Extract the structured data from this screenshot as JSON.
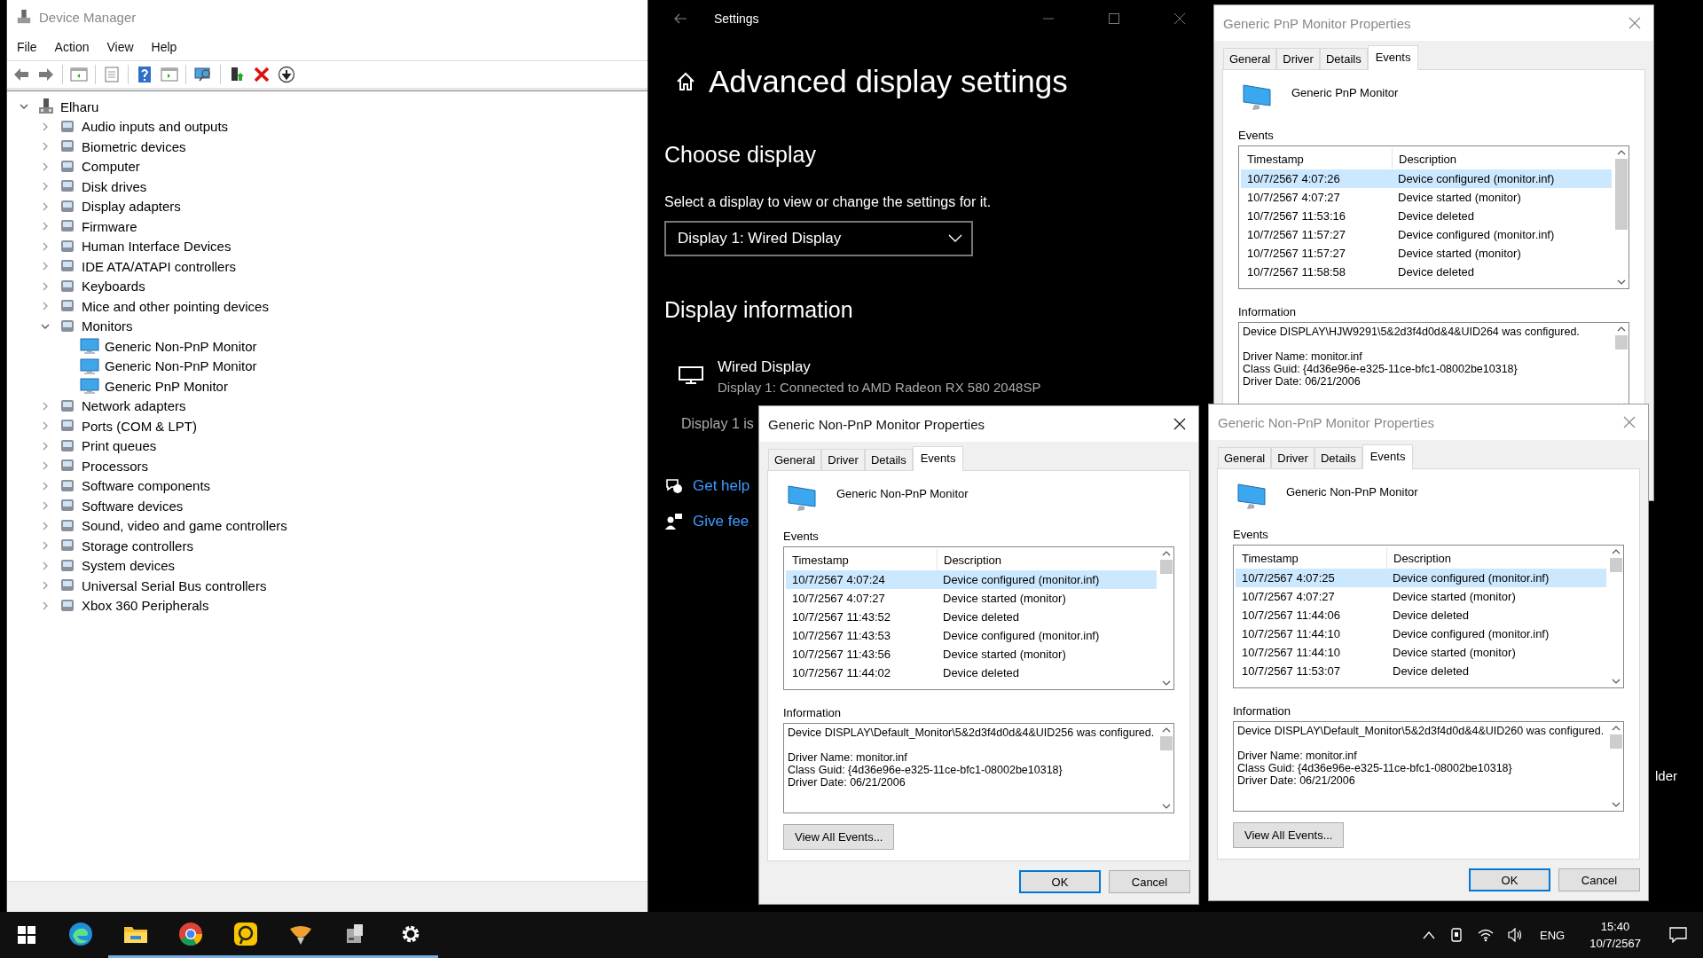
{
  "device_manager": {
    "title": "Device Manager",
    "menu": [
      "File",
      "Action",
      "View",
      "Help"
    ],
    "tree": {
      "label": "Elharu",
      "expanded": true,
      "children": [
        {
          "label": "Audio inputs and outputs",
          "expanded": false
        },
        {
          "label": "Biometric devices",
          "expanded": false
        },
        {
          "label": "Computer",
          "expanded": false
        },
        {
          "label": "Disk drives",
          "expanded": false
        },
        {
          "label": "Display adapters",
          "expanded": false
        },
        {
          "label": "Firmware",
          "expanded": false
        },
        {
          "label": "Human Interface Devices",
          "expanded": false
        },
        {
          "label": "IDE ATA/ATAPI controllers",
          "expanded": false
        },
        {
          "label": "Keyboards",
          "expanded": false
        },
        {
          "label": "Mice and other pointing devices",
          "expanded": false
        },
        {
          "label": "Monitors",
          "expanded": true,
          "children": [
            {
              "label": "Generic Non-PnP Monitor"
            },
            {
              "label": "Generic Non-PnP Monitor"
            },
            {
              "label": "Generic PnP Monitor"
            }
          ]
        },
        {
          "label": "Network adapters",
          "expanded": false
        },
        {
          "label": "Ports (COM & LPT)",
          "expanded": false
        },
        {
          "label": "Print queues",
          "expanded": false
        },
        {
          "label": "Processors",
          "expanded": false
        },
        {
          "label": "Software components",
          "expanded": false
        },
        {
          "label": "Software devices",
          "expanded": false
        },
        {
          "label": "Sound, video and game controllers",
          "expanded": false
        },
        {
          "label": "Storage controllers",
          "expanded": false
        },
        {
          "label": "System devices",
          "expanded": false
        },
        {
          "label": "Universal Serial Bus controllers",
          "expanded": false
        },
        {
          "label": "Xbox 360 Peripherals",
          "expanded": false
        }
      ]
    }
  },
  "settings": {
    "title": "Settings",
    "heading": "Advanced display settings",
    "choose_heading": "Choose display",
    "prompt": "Select a display to view or change the settings for it.",
    "display_select": "Display 1: Wired Display",
    "info_heading": "Display information",
    "display_name": "Wired Display",
    "display_detail": "Display 1: Connected to AMD Radeon RX 580 2048SP",
    "cut_text": "Display 1 is",
    "links": [
      "Get help",
      "Give fee"
    ]
  },
  "dialogs": [
    {
      "title": "Generic PnP Monitor Properties",
      "active": false,
      "tabs": [
        {
          "label": "General",
          "selected": false
        },
        {
          "label": "Driver",
          "selected": false
        },
        {
          "label": "Details",
          "selected": false
        },
        {
          "label": "Events",
          "selected": true
        }
      ],
      "device": "Generic PnP Monitor",
      "events_label": "Events",
      "columns": [
        "Timestamp",
        "Description"
      ],
      "rows": [
        {
          "timestamp": "10/7/2567 4:07:26",
          "description": "Device configured (monitor.inf)",
          "selected": true
        },
        {
          "timestamp": "10/7/2567 4:07:27",
          "description": "Device started (monitor)",
          "selected": false
        },
        {
          "timestamp": "10/7/2567 11:53:16",
          "description": "Device deleted",
          "selected": false
        },
        {
          "timestamp": "10/7/2567 11:57:27",
          "description": "Device configured (monitor.inf)",
          "selected": false
        },
        {
          "timestamp": "10/7/2567 11:57:27",
          "description": "Device started (monitor)",
          "selected": false
        },
        {
          "timestamp": "10/7/2567 11:58:58",
          "description": "Device deleted",
          "selected": false
        }
      ],
      "information_label": "Information",
      "information": [
        "Device DISPLAY\\HJW9291\\5&2d3f4d0d&4&UID264 was configured.",
        "Driver Name: monitor.inf",
        "Class Guid: {4d36e96e-e325-11ce-bfc1-08002be10318}",
        "Driver Date: 06/21/2006"
      ]
    },
    {
      "title": "Generic Non-PnP Monitor Properties",
      "active": true,
      "tabs": [
        {
          "label": "General",
          "selected": false
        },
        {
          "label": "Driver",
          "selected": false
        },
        {
          "label": "Details",
          "selected": false
        },
        {
          "label": "Events",
          "selected": true
        }
      ],
      "device": "Generic Non-PnP Monitor",
      "events_label": "Events",
      "columns": [
        "Timestamp",
        "Description"
      ],
      "rows": [
        {
          "timestamp": "10/7/2567 4:07:24",
          "description": "Device configured (monitor.inf)",
          "selected": true
        },
        {
          "timestamp": "10/7/2567 4:07:27",
          "description": "Device started (monitor)",
          "selected": false
        },
        {
          "timestamp": "10/7/2567 11:43:52",
          "description": "Device deleted",
          "selected": false
        },
        {
          "timestamp": "10/7/2567 11:43:53",
          "description": "Device configured (monitor.inf)",
          "selected": false
        },
        {
          "timestamp": "10/7/2567 11:43:56",
          "description": "Device started (monitor)",
          "selected": false
        },
        {
          "timestamp": "10/7/2567 11:44:02",
          "description": "Device deleted",
          "selected": false
        }
      ],
      "information_label": "Information",
      "information": [
        "Device DISPLAY\\Default_Monitor\\5&2d3f4d0d&4&UID256 was configured.",
        "Driver Name: monitor.inf",
        "Class Guid: {4d36e96e-e325-11ce-bfc1-08002be10318}",
        "Driver Date: 06/21/2006"
      ],
      "view_all_button": "View All Events...",
      "buttons": [
        "OK",
        "Cancel"
      ]
    },
    {
      "title": "Generic Non-PnP Monitor Properties",
      "active": false,
      "tabs": [
        {
          "label": "General",
          "selected": false
        },
        {
          "label": "Driver",
          "selected": false
        },
        {
          "label": "Details",
          "selected": false
        },
        {
          "label": "Events",
          "selected": true
        }
      ],
      "device": "Generic Non-PnP Monitor",
      "events_label": "Events",
      "columns": [
        "Timestamp",
        "Description"
      ],
      "rows": [
        {
          "timestamp": "10/7/2567 4:07:25",
          "description": "Device configured (monitor.inf)",
          "selected": true
        },
        {
          "timestamp": "10/7/2567 4:07:27",
          "description": "Device started (monitor)",
          "selected": false
        },
        {
          "timestamp": "10/7/2567 11:44:06",
          "description": "Device deleted",
          "selected": false
        },
        {
          "timestamp": "10/7/2567 11:44:10",
          "description": "Device configured (monitor.inf)",
          "selected": false
        },
        {
          "timestamp": "10/7/2567 11:44:10",
          "description": "Device started (monitor)",
          "selected": false
        },
        {
          "timestamp": "10/7/2567 11:53:07",
          "description": "Device deleted",
          "selected": false
        }
      ],
      "information_label": "Information",
      "information": [
        "Device DISPLAY\\Default_Monitor\\5&2d3f4d0d&4&UID260 was configured.",
        "Driver Name: monitor.inf",
        "Class Guid: {4d36e96e-e325-11ce-bfc1-08002be10318}",
        "Driver Date: 06/21/2006"
      ],
      "view_all_button": "View All Events...",
      "buttons": [
        "OK",
        "Cancel"
      ]
    }
  ],
  "desktop": {
    "icon_label": "lder"
  },
  "taskbar": {
    "apps": [
      {
        "kind": "edge",
        "running": false
      },
      {
        "kind": "explorer",
        "running": true
      },
      {
        "kind": "chrome",
        "running": true
      },
      {
        "kind": "yellow",
        "running": true
      },
      {
        "kind": "bowl",
        "running": true
      },
      {
        "kind": "server",
        "running": true
      },
      {
        "kind": "gear",
        "running": true
      }
    ],
    "language": "ENG",
    "time": "15:40",
    "date": "10/7/2567"
  }
}
